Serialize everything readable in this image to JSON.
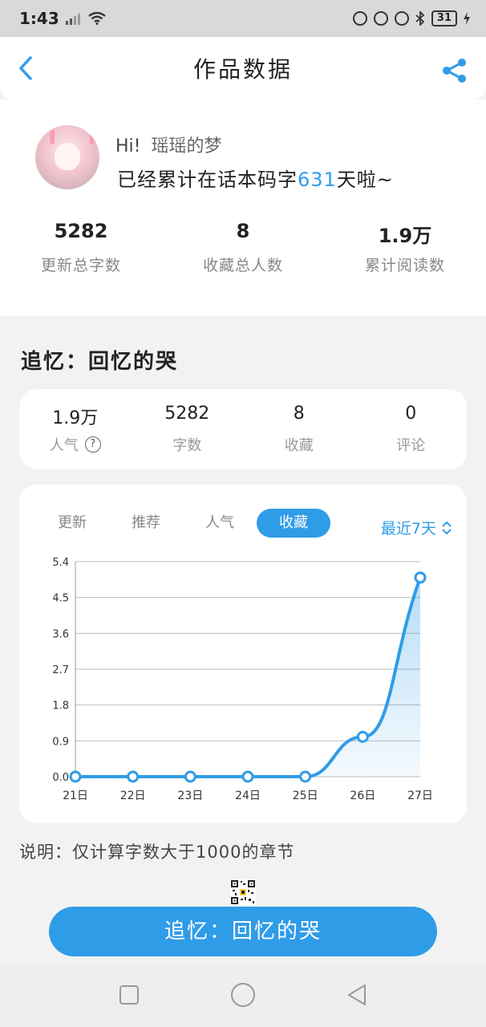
{
  "status_bar": {
    "time": "1:43",
    "battery": "31"
  },
  "header": {
    "title": "作品数据"
  },
  "profile": {
    "greeting": "Hi!",
    "username": "瑶瑶的梦",
    "days_prefix": "已经累计在话本码字",
    "days_value": "631",
    "days_suffix": "天啦~",
    "stats": [
      {
        "value": "5282",
        "label": "更新总字数"
      },
      {
        "value": "8",
        "label": "收藏总人数"
      },
      {
        "value": "1.9万",
        "label": "累计阅读数"
      }
    ]
  },
  "book": {
    "title": "追忆：回忆的哭",
    "stats": [
      {
        "value": "1.9万",
        "label": "人气"
      },
      {
        "value": "5282",
        "label": "字数"
      },
      {
        "value": "8",
        "label": "收藏"
      },
      {
        "value": "0",
        "label": "评论"
      }
    ]
  },
  "chart_tabs": {
    "items": [
      "更新",
      "推荐",
      "人气",
      "收藏"
    ],
    "active_index": 3,
    "range_label": "最近7天"
  },
  "chart_data": {
    "type": "area",
    "categories": [
      "21日",
      "22日",
      "23日",
      "24日",
      "25日",
      "26日",
      "27日"
    ],
    "values": [
      0,
      0,
      0,
      0,
      0,
      1,
      5
    ],
    "y_ticks": [
      "0.0",
      "0.9",
      "1.8",
      "2.7",
      "3.6",
      "4.5",
      "5.4"
    ],
    "ylim": [
      0,
      5.4
    ],
    "grid": true,
    "line_color": "#2f9ce8"
  },
  "note": "说明：仅计算字数大于1000的章节",
  "cta_label": "追忆：回忆的哭",
  "colors": {
    "accent": "#2f9ce8"
  }
}
